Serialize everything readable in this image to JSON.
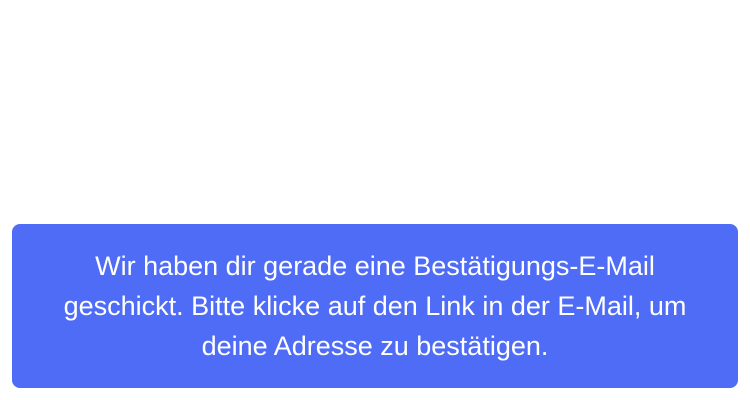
{
  "colors": {
    "background": "#ffffff",
    "toast_background": "#4f6cf6",
    "toast_text": "#ffffff"
  },
  "toast": {
    "message": "Wir haben dir gerade eine Bestätigungs-E-Mail geschickt. Bitte klicke auf den Link in der E-Mail, um deine Adresse zu bestätigen."
  }
}
